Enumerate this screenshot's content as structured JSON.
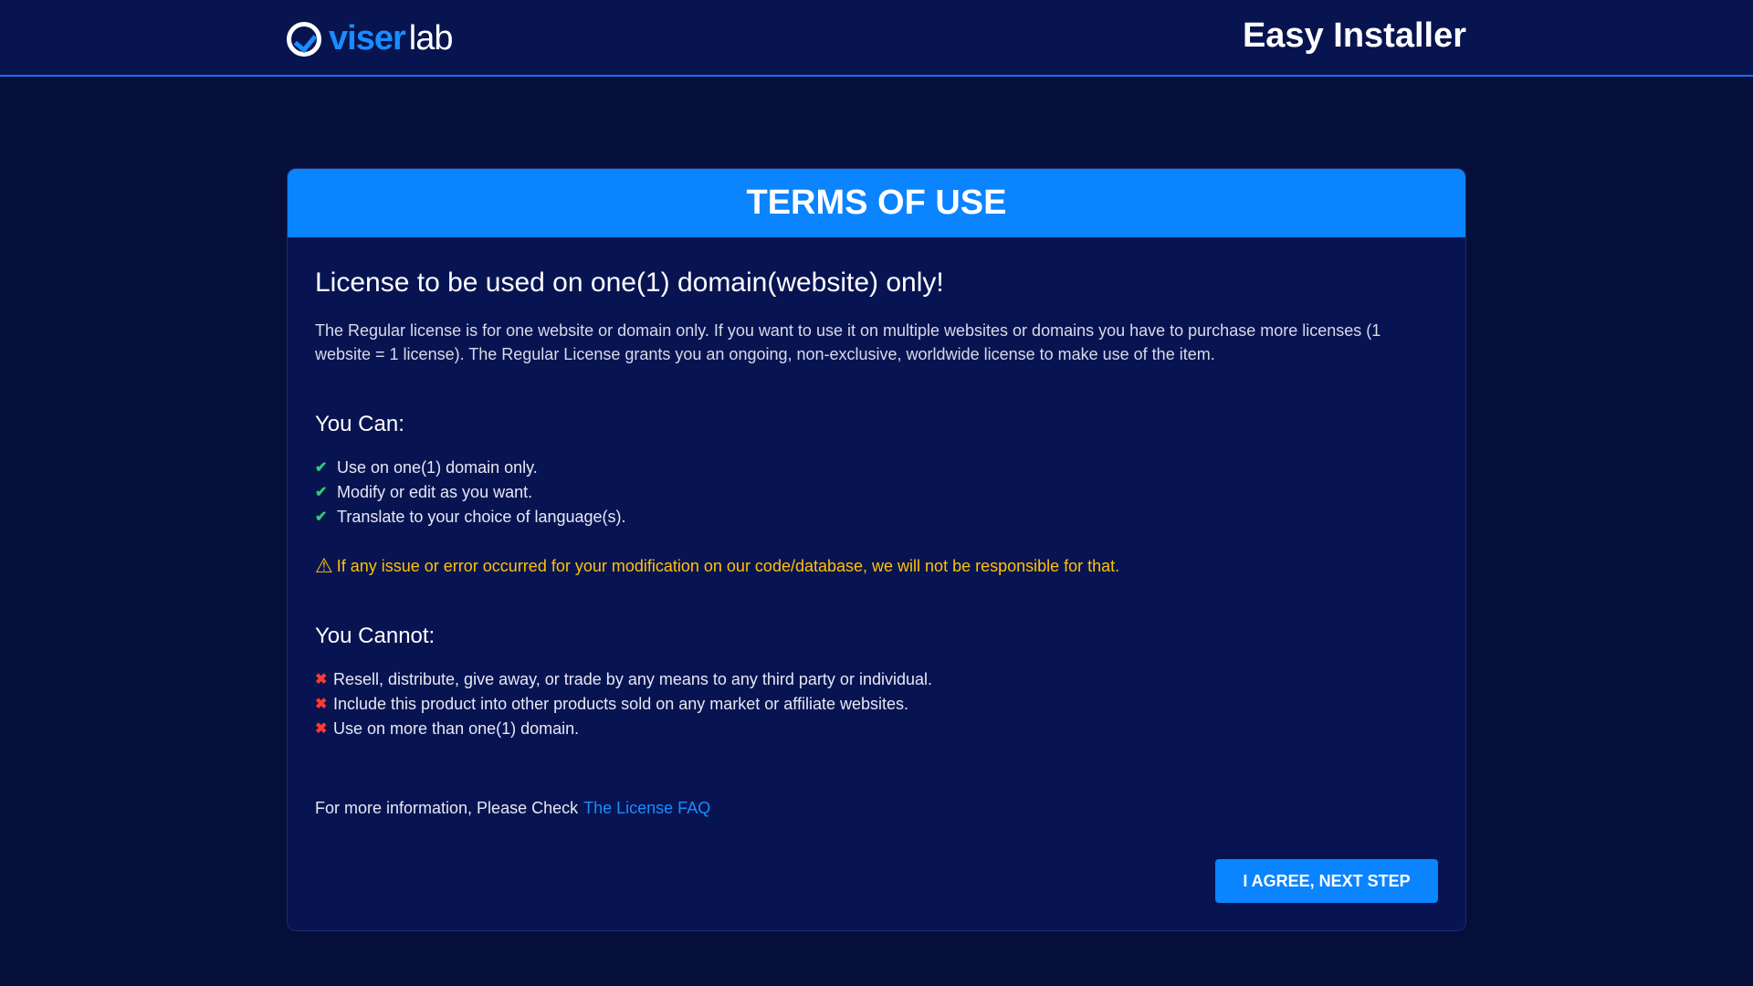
{
  "header": {
    "logo_part1": "viser",
    "logo_part2": "lab",
    "title": "Easy Installer"
  },
  "card": {
    "title": "TERMS OF USE",
    "heading": "License to be used on one(1) domain(website) only!",
    "description": "The Regular license is for one website or domain only. If you want to use it on multiple websites or domains you have to purchase more licenses (1 website = 1 license). The Regular License grants you an ongoing, non-exclusive, worldwide license to make use of the item.",
    "can_title": "You Can:",
    "can": [
      "Use on one(1) domain only.",
      "Modify or edit as you want.",
      "Translate to your choice of language(s)."
    ],
    "warning": "If any issue or error occurred for your modification on our code/database, we will not be responsible for that.",
    "cannot_title": "You Cannot:",
    "cannot": [
      "Resell, distribute, give away, or trade by any means to any third party or individual.",
      "Include this product into other products sold on any market or affiliate websites.",
      "Use on more than one(1) domain."
    ],
    "more_text": "For more information, Please Check",
    "faq_link": "The License FAQ",
    "agree_button": "I AGREE, NEXT STEP"
  }
}
